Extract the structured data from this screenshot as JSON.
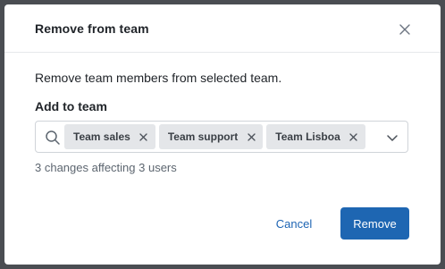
{
  "modal": {
    "title": "Remove from team",
    "description": "Remove team members from selected team.",
    "field_label": "Add to team",
    "selected_teams": [
      {
        "label": "Team sales"
      },
      {
        "label": "Team support"
      },
      {
        "label": "Team Lisboa"
      }
    ],
    "changes_text": "3 changes affecting 3 users",
    "cancel_label": "Cancel",
    "remove_label": "Remove"
  },
  "icons": {
    "close": "close-icon",
    "search": "search-icon",
    "tag_remove": "close-icon",
    "dropdown": "chevron-down-icon"
  },
  "colors": {
    "primary": "#1e66b2",
    "link": "#1d64b3",
    "tag_bg": "#e4e6e9",
    "backdrop": "#4a4d52"
  }
}
